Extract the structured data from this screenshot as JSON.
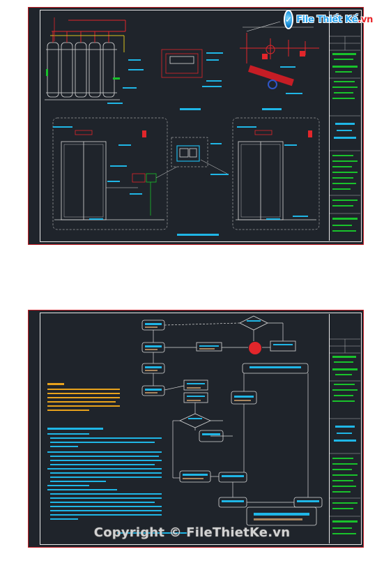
{
  "watermark": {
    "logo_brand": "File Thiết Kế",
    "logo_domain": ".vn",
    "copyright": "Copyright © FileThietKe.vn"
  },
  "colors": {
    "background": "#1f242b",
    "frame": "#c61d25",
    "annotation": "#1fb6e6",
    "pipe_red": "#e2262b",
    "line_green": "#19c22b",
    "cylinder": "#d9d9d9"
  },
  "sheet1": {
    "icons": [
      "gas-cylinder-bank",
      "control-panel",
      "valve-assembly",
      "door-elevation",
      "alarm-bell",
      "manual-release-station"
    ]
  },
  "sheet2": {
    "icons": [
      "flowchart",
      "decision-diamond",
      "notes-block"
    ]
  }
}
